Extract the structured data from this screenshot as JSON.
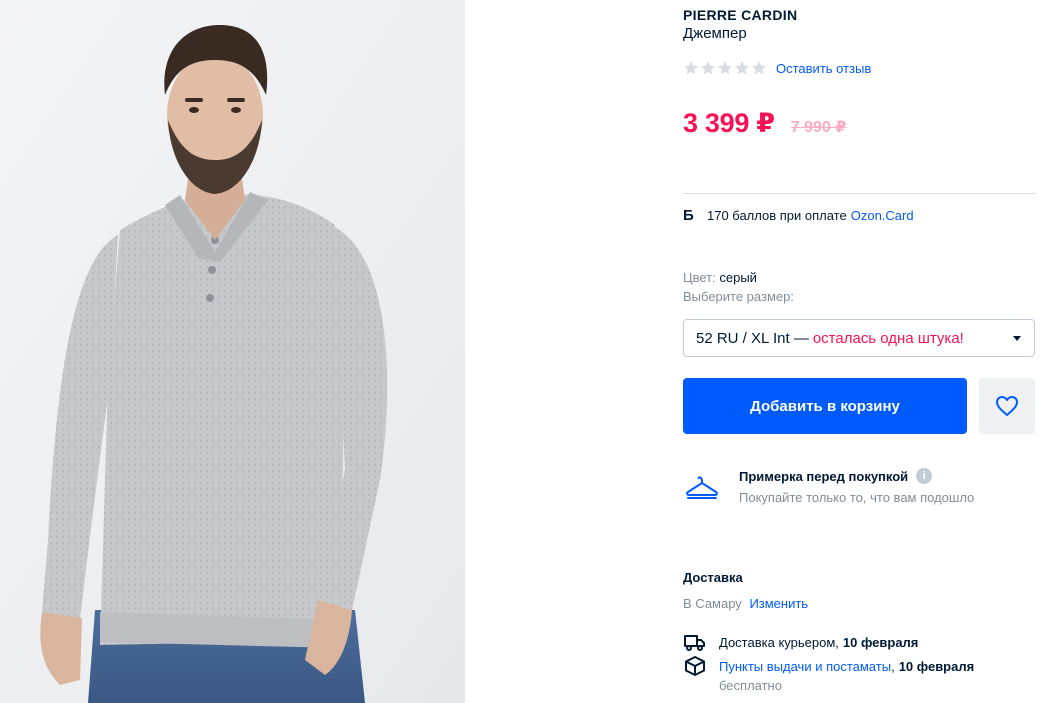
{
  "product": {
    "brand": "PIERRE CARDIN",
    "title": "Джемпер",
    "rating_stars": 0,
    "review_link": "Оставить отзыв",
    "price": "3 399 ₽",
    "old_price": "7 990 ₽",
    "image_alt": "man-in-grey-polo-jumper"
  },
  "bonus": {
    "icon": "Б",
    "text": "170 баллов при оплате",
    "link": "Ozon.Card"
  },
  "options": {
    "color_label": "Цвет:",
    "color_value": "серый",
    "size_label": "Выберите размер:",
    "size_selected": "52 RU / XL Int —",
    "size_warning": "осталась одна штука!"
  },
  "actions": {
    "cart_label": "Добавить в корзину"
  },
  "fitting": {
    "title": "Примерка перед покупкой",
    "info_icon": "i",
    "subtitle": "Покупайте только то, что вам подошло"
  },
  "delivery": {
    "heading": "Доставка",
    "region_prefix": "В Самару",
    "region_change": "Изменить",
    "courier_text": "Доставка курьером,",
    "courier_date": "10 февраля",
    "pickup_link": "Пункты выдачи и постаматы",
    "pickup_date": "10 февраля",
    "pickup_price": "бесплатно"
  },
  "colors": {
    "accent": "#005bff",
    "price": "#f91155",
    "text": "#001a34",
    "muted": "#808d9a"
  }
}
